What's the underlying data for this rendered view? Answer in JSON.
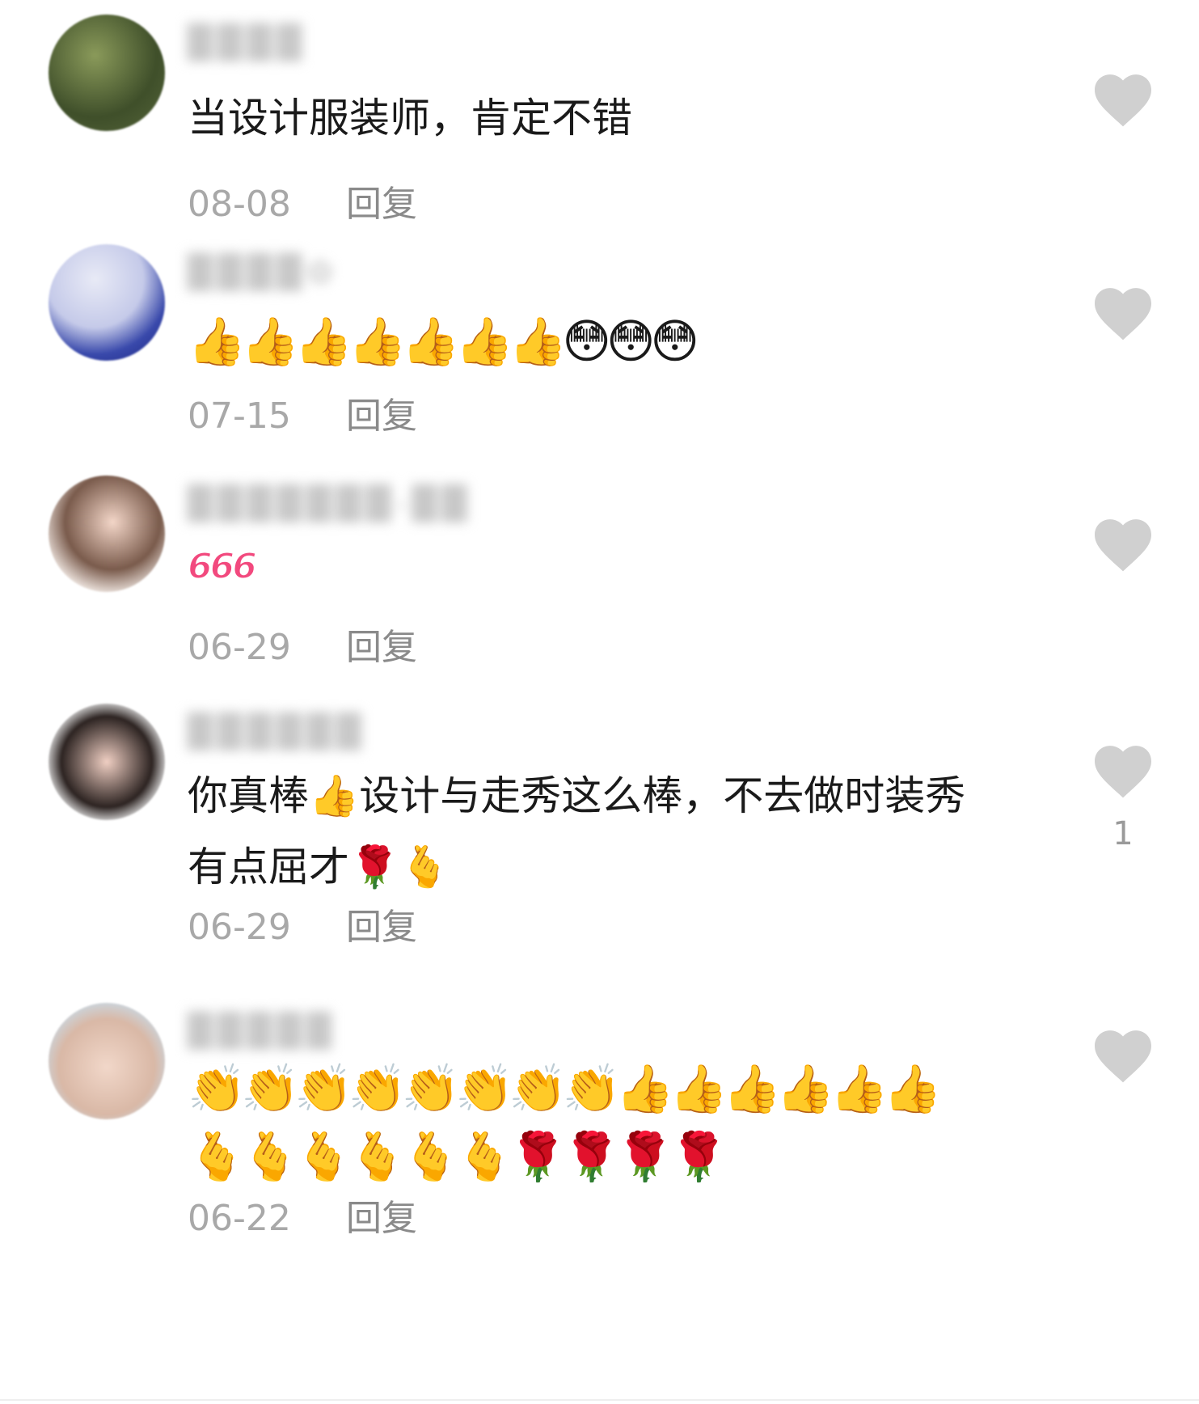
{
  "comments": [
    {
      "username": "████",
      "text": "当设计服装师，肯定不错",
      "date": "08-08",
      "reply": "回复",
      "like_count": ""
    },
    {
      "username": "████✿",
      "text": "👍👍👍👍👍👍👍😳😳😳",
      "date": "07-15",
      "reply": "回复",
      "like_count": ""
    },
    {
      "username": "███████-██",
      "text": "666",
      "date": "06-29",
      "reply": "回复",
      "like_count": ""
    },
    {
      "username": "██████",
      "text": "你真棒👍设计与走秀这么棒，不去做时装秀有点屈才🌹🫰",
      "date": "06-29",
      "reply": "回复",
      "like_count": "1"
    },
    {
      "username": "█████",
      "text": "👏👏👏👏👏👏👏👏👍👍👍👍👍👍🫰🫰🫰🫰🫰🫰🌹🌹🌹🌹",
      "date": "06-22",
      "reply": "回复",
      "like_count": ""
    }
  ],
  "icons": {
    "like": "heart-icon",
    "like_color": "#d0d0d0"
  }
}
